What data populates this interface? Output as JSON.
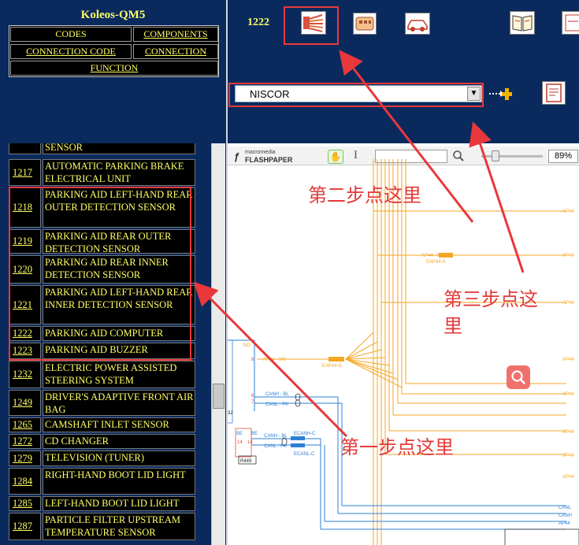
{
  "nav": {
    "title": "Koleos-QM5",
    "links": {
      "codes": "CODES",
      "components": "COMPONENTS",
      "connection_code": "CONNECTION CODE",
      "connection": "CONNECTION",
      "function": "FUNCTION"
    }
  },
  "toolbar": {
    "code_label": "1222",
    "icons": [
      "connector-fan-icon",
      "connector-block-icon",
      "car-icon",
      "book-icon",
      "document-icon",
      "add-arrow-icon",
      "report-icon"
    ],
    "select_value": "NISCOR"
  },
  "list": {
    "partial_top": "SENSOR",
    "rows": [
      {
        "code": "1217",
        "desc": "AUTOMATIC PARKING BRAKE ELECTRICAL UNIT"
      },
      {
        "code": "1218",
        "desc": "PARKING AID LEFT-HAND REAR OUTER DETECTION SENSOR"
      },
      {
        "code": "1219",
        "desc": "PARKING AID REAR OUTER DETECTION SENSOR"
      },
      {
        "code": "1220",
        "desc": "PARKING AID REAR INNER DETECTION SENSOR"
      },
      {
        "code": "1221",
        "desc": "PARKING AID LEFT-HAND REAR INNER DETECTION SENSOR"
      },
      {
        "code": "1222",
        "desc": "PARKING AID COMPUTER"
      },
      {
        "code": "1223",
        "desc": "PARKING AID BUZZER"
      },
      {
        "code": "1232",
        "desc": "ELECTRIC POWER ASSISTED STEERING SYSTEM"
      },
      {
        "code": "1249",
        "desc": "DRIVER'S ADAPTIVE FRONT AIR BAG"
      },
      {
        "code": "1265",
        "desc": "CAMSHAFT INLET SENSOR"
      },
      {
        "code": "1272",
        "desc": "CD CHANGER"
      },
      {
        "code": "1279",
        "desc": "TELEVISION (TUNER)"
      },
      {
        "code": "1284",
        "desc": "RIGHT-HAND BOOT LID LIGHT"
      },
      {
        "code": "1285",
        "desc": "LEFT-HAND BOOT LID LIGHT"
      },
      {
        "code": "1287",
        "desc": "PARTICLE FILTER UPSTREAM TEMPERATURE SENSOR"
      }
    ]
  },
  "viewer": {
    "logo_top": "macromedia",
    "logo_bottom": "FLASHPAPER",
    "zoom": "89%"
  },
  "diagram": {
    "labels": {
      "ap44_a": "AP44",
      "ap44_b": "AP44",
      "ap44_c": "AP44",
      "ap44_d": "AP44",
      "ap44_e": "AP44",
      "ap44_f": "AP44",
      "ap44_g": "AP44",
      "ap44_h": "AP44",
      "nd": "ND",
      "ap44vn": "AP44 - VN",
      "eap44d": "EAP44-D",
      "eap44a": "EAP44-A",
      "ap44nm": "AP44 · NN",
      "canh_bl_1": "CANH - BL",
      "canl_pk_1": "CANL - PK",
      "canh_bl_2": "CANH - BL",
      "canl_pk_2": "CANL - PK",
      "be1": "BE",
      "be2": "BE",
      "ecanl_c": "ECANL-C",
      "ecanh_c": "ECANH-C",
      "r449": "R449",
      "r32": "32",
      "pin8": "8",
      "pin6": "6",
      "pin7": "7",
      "pin3": "3",
      "pin14a": "14",
      "pin14b": "14",
      "canl_r": "CANL",
      "canh_r": "CANH",
      "ap44_r": "AP44"
    }
  },
  "annotations": {
    "step1": "第一步点这里",
    "step2": "第二步点这里",
    "step3_line1": "第三步点这",
    "step3_line2": "里"
  },
  "colors": {
    "frame_bg": "#0a2a5e",
    "text_yellow": "#ffff66",
    "highlight_red": "#e8383b",
    "wire_orange": "#f5a623",
    "wire_blue": "#2d7fd6"
  }
}
